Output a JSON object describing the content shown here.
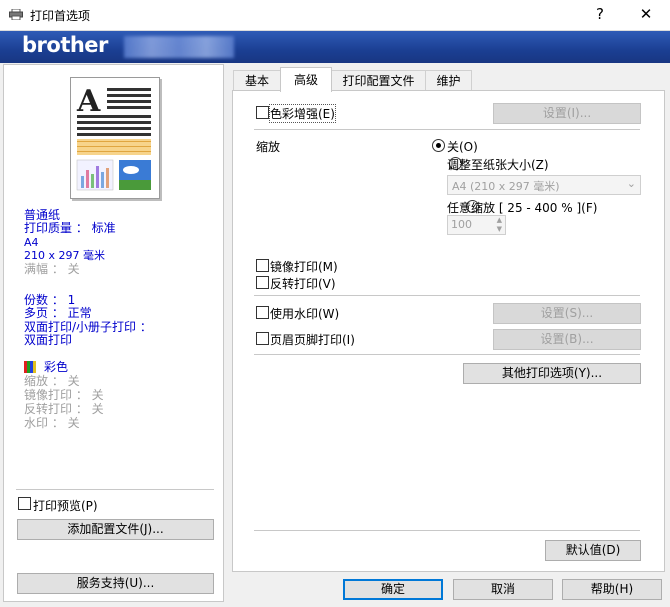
{
  "window": {
    "title": "打印首选项",
    "help": "?",
    "close": "✕"
  },
  "banner": {
    "logo": "brother"
  },
  "tabs": [
    {
      "label": "基本"
    },
    {
      "label": "高级"
    },
    {
      "label": "打印配置文件"
    },
    {
      "label": "维护"
    }
  ],
  "summary": {
    "media": "普通纸",
    "quality": "打印质量 ： 标准",
    "paper": "A4",
    "size": "210 x 297 毫米",
    "borderless": "满幅 ： 关",
    "copies": "份数 ： 1",
    "multipage": "多页 ： 正常",
    "duplex_label": "双面打印/小册子打印 ：",
    "duplex_value": "双面打印",
    "color_mode": "彩色",
    "scaling": "缩放 ： 关",
    "mirror": "镜像打印 ： 关",
    "reverse": "反转打印 ： 关",
    "watermark": "水印 ： 关"
  },
  "left": {
    "print_preview": "打印预览(P)",
    "add_profile": "添加配置文件(J)...",
    "support": "服务支持(U)..."
  },
  "advanced": {
    "color_enhance": "色彩增强(E)",
    "color_settings": "设置(I)...",
    "scaling_label": "缩放",
    "scale_off": "关(O)",
    "scale_fit": "调整至纸张大小(Z)",
    "fit_paper": "A4 (210 x 297 毫米)",
    "scale_free": "任意缩放 [ 25 - 400 % ](F)",
    "scale_value": "100",
    "mirror_print": "镜像打印(M)",
    "reverse_print": "反转打印(V)",
    "use_watermark": "使用水印(W)",
    "watermark_settings": "设置(S)...",
    "header_footer": "页眉页脚打印(I)",
    "header_footer_settings": "设置(B)...",
    "other_options": "其他打印选项(Y)...",
    "defaults": "默认值(D)"
  },
  "footer": {
    "ok": "确定",
    "cancel": "取消",
    "help": "帮助(H)"
  }
}
